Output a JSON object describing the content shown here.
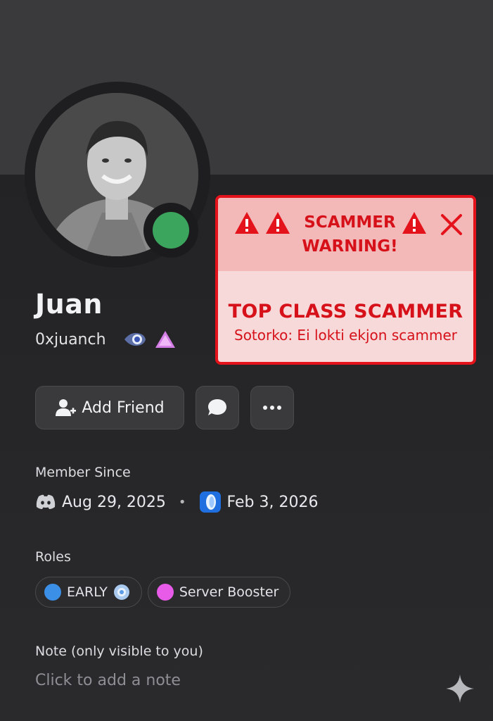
{
  "profile": {
    "display_name": "Juan",
    "username": "0xjuanch",
    "status_color": "#3ba55d"
  },
  "warning": {
    "title": "SCAMMER WARNING!",
    "heading": "TOP CLASS SCAMMER",
    "subtext": "Sotorko: Ei lokti ekjon scammer",
    "accent_color": "#d6111a"
  },
  "actions": {
    "add_friend_label": "Add Friend",
    "message_icon": "chat-bubble-icon",
    "more_icon": "ellipsis-icon"
  },
  "member_since": {
    "label": "Member Since",
    "discord_date": "Aug 29, 2025",
    "separator": "•",
    "server_date": "Feb 3, 2026"
  },
  "roles": {
    "label": "Roles",
    "items": [
      {
        "name": "EARLY",
        "color": "#3b8fe6"
      },
      {
        "name": "Server Booster",
        "color": "#e85be8"
      }
    ]
  },
  "note": {
    "label": "Note (only visible to you)",
    "placeholder": "Click to add a note"
  }
}
